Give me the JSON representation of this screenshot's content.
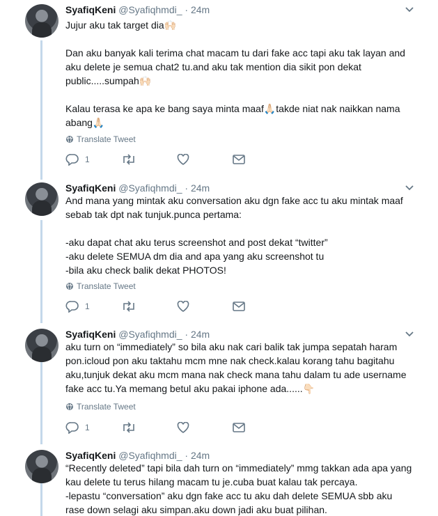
{
  "tweets": [
    {
      "name": "SyafiqKeni",
      "handle": "@Syafiqhmdi_",
      "time": "· 24m",
      "paragraphs": [
        "Jujur aku tak target dia🙌🏻",
        "Dan aku banyak kali terima chat macam tu dari fake acc tapi aku tak layan and aku delete je semua chat2 tu.and aku tak mention dia sikit pon dekat public.....sumpah🙌🏻",
        "Kalau terasa ke apa ke bang saya minta maaf🙏🏻takde niat nak naikkan nama abang🙏🏻"
      ],
      "translate": "Translate Tweet",
      "replies": "1"
    },
    {
      "name": "SyafiqKeni",
      "handle": "@Syafiqhmdi_",
      "time": "· 24m",
      "paragraphs": [
        "And mana yang mintak aku conversation aku dgn fake acc tu aku mintak maaf sebab tak dpt nak tunjuk.punca pertama:",
        "-aku dapat chat aku terus screenshot and post dekat “twitter”\n-aku delete SEMUA dm dia and apa yang aku screenshot tu\n-bila aku check balik dekat PHOTOS!"
      ],
      "translate": "Translate Tweet",
      "replies": "1"
    },
    {
      "name": "SyafiqKeni",
      "handle": "@Syafiqhmdi_",
      "time": "· 24m",
      "paragraphs": [
        "aku turn on “immediately” so bila aku nak cari balik tak jumpa sepatah haram pon.icloud pon aku taktahu mcm mne nak check.kalau korang tahu bagitahu aku,tunjuk dekat aku mcm mana nak check mana tahu dalam tu ade username fake acc tu.Ya memang betul aku pakai iphone ada......👇🏻"
      ],
      "translate": "Translate Tweet",
      "replies": "1"
    },
    {
      "name": "SyafiqKeni",
      "handle": "@Syafiqhmdi_",
      "time": "· 24m",
      "paragraphs": [
        "“Recently deleted” tapi bila dah turn on “immediately” mmg takkan ada apa yang kau delete tu terus hilang macam tu je.cuba buat kalau tak percaya.\n-lepastu “conversation” aku dgn fake acc tu aku dah delete SEMUA sbb aku rase down selagi aku simpan.aku down jadi aku buat pilihan."
      ]
    }
  ],
  "colors": {
    "thread_line": "#c4d8ea",
    "secondary_text": "#657786",
    "primary_text": "#14171a"
  },
  "icons": [
    "caret-down-icon",
    "globe-icon",
    "reply-icon",
    "retweet-icon",
    "like-icon",
    "dm-icon"
  ]
}
